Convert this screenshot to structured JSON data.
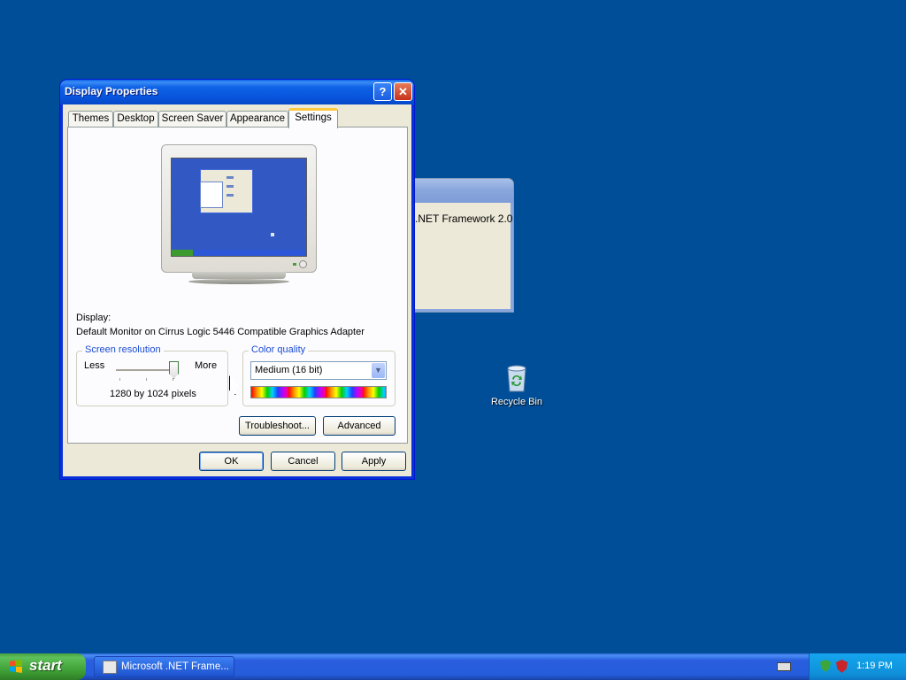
{
  "background_window": {
    "text": ".NET Framework 2.0"
  },
  "desktop": {
    "recycle_bin_label": "Recycle Bin",
    "recycle_bin_icon": "recycle-bin-icon"
  },
  "dialog": {
    "title": "Display Properties",
    "help_label": "?",
    "close_label": "✕",
    "tabs": [
      {
        "label": "Themes",
        "active": false
      },
      {
        "label": "Desktop",
        "active": false
      },
      {
        "label": "Screen Saver",
        "active": false
      },
      {
        "label": "Appearance",
        "active": false
      },
      {
        "label": "Settings",
        "active": true
      }
    ],
    "display_label": "Display:",
    "display_value": "Default Monitor on Cirrus Logic 5446 Compatible Graphics Adapter",
    "resolution": {
      "legend": "Screen resolution",
      "less": "Less",
      "more": "More",
      "value": "1280 by 1024 pixels",
      "slider_position": 1.0
    },
    "color_quality": {
      "legend": "Color quality",
      "selected": "Medium (16 bit)"
    },
    "buttons": {
      "troubleshoot": "Troubleshoot...",
      "advanced": "Advanced",
      "ok": "OK",
      "cancel": "Cancel",
      "apply": "Apply"
    }
  },
  "taskbar": {
    "start_label": "start",
    "task_item": "Microsoft .NET Frame...",
    "clock": "1:19 PM"
  },
  "colors": {
    "desktop": "#004e98",
    "title_bar": "#0855dd",
    "dialog_face": "#ece9d8",
    "active_tab_accent": "#ffc83c",
    "group_legend": "#1a4bd2"
  }
}
